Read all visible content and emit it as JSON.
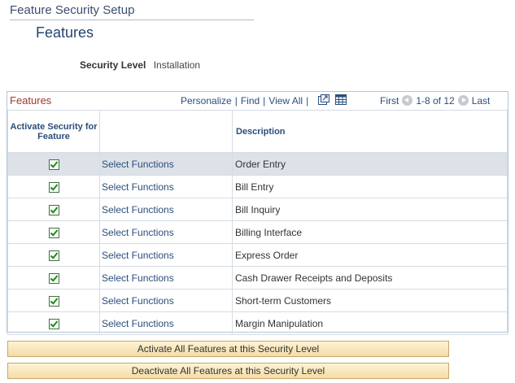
{
  "header": {
    "title": "Feature Security Setup"
  },
  "page": {
    "title": "Features"
  },
  "security": {
    "label": "Security Level",
    "value": "Installation"
  },
  "grid": {
    "title": "Features",
    "nav": {
      "personalize": "Personalize",
      "find": "Find",
      "view_all": "View All",
      "sep": "|"
    },
    "paging": {
      "first": "First",
      "range": "1-8 of 12",
      "last": "Last"
    },
    "columns": [
      "Activate Security for Feature",
      "",
      "Description"
    ],
    "rows": [
      {
        "checked": true,
        "link": "Select Functions",
        "description": "Order Entry"
      },
      {
        "checked": true,
        "link": "Select Functions",
        "description": "Bill Entry"
      },
      {
        "checked": true,
        "link": "Select Functions",
        "description": "Bill Inquiry"
      },
      {
        "checked": true,
        "link": "Select Functions",
        "description": "Billing Interface"
      },
      {
        "checked": true,
        "link": "Select Functions",
        "description": "Express Order"
      },
      {
        "checked": true,
        "link": "Select Functions",
        "description": "Cash Drawer Receipts and Deposits"
      },
      {
        "checked": true,
        "link": "Select Functions",
        "description": "Short-term Customers"
      },
      {
        "checked": true,
        "link": "Select Functions",
        "description": "Margin Manipulation"
      }
    ]
  },
  "buttons": {
    "activate": "Activate All Features at this Security Level",
    "deactivate": "Deactivate All Features at this Security Level"
  },
  "icons": [
    "download-icon",
    "grid-icon",
    "previous-icon",
    "next-icon",
    "checkbox-checked-icon"
  ],
  "colors": {
    "title": "#23456f",
    "link": "#2b4e7c",
    "grid_title": "#a4372a",
    "button_bg": "#f5dca8",
    "selected_row": "#dde2e8"
  }
}
